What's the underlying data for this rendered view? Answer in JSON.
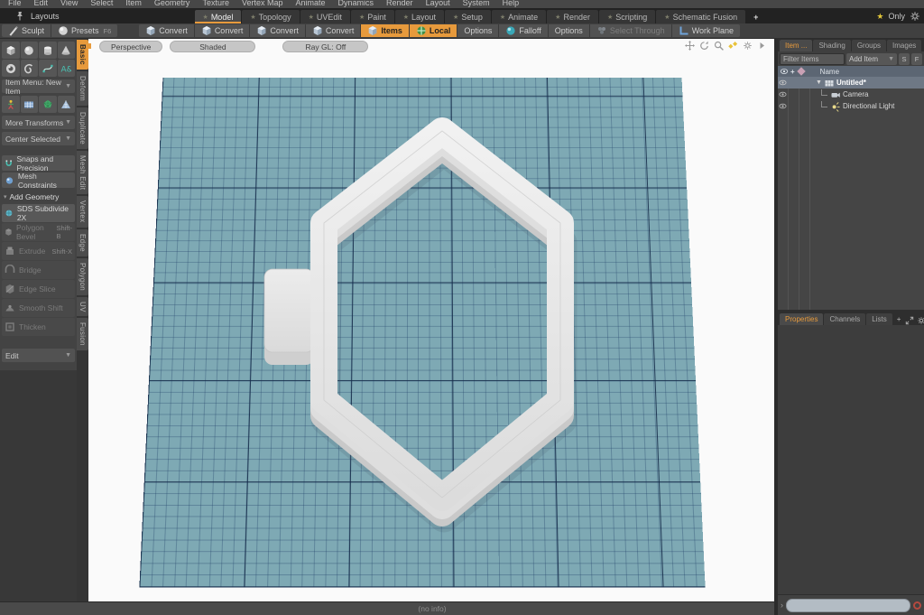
{
  "menubar": {
    "items": [
      "File",
      "Edit",
      "View",
      "Select",
      "Item",
      "Geometry",
      "Texture",
      "Vertex Map",
      "Animate",
      "Dynamics",
      "Render",
      "Layout",
      "System",
      "Help"
    ]
  },
  "layouts_bar": {
    "layouts_label": "Layouts",
    "tabs": [
      {
        "label": "Model",
        "active": true
      },
      {
        "label": "Topology"
      },
      {
        "label": "UVEdit"
      },
      {
        "label": "Paint"
      },
      {
        "label": "Layout"
      },
      {
        "label": "Setup"
      },
      {
        "label": "Animate"
      },
      {
        "label": "Render"
      },
      {
        "label": "Scripting"
      },
      {
        "label": "Schematic Fusion"
      }
    ],
    "add_tab_label": "+",
    "only_label": "Only"
  },
  "toolbar": {
    "buttons": [
      {
        "label": "Sculpt",
        "icon": "brush"
      },
      {
        "label": "Presets",
        "shortcut": "F6",
        "icon": "sphere"
      },
      {
        "label": "Convert",
        "icon": "cube"
      },
      {
        "label": "Convert",
        "icon": "cube"
      },
      {
        "label": "Convert",
        "icon": "cube"
      },
      {
        "label": "Convert",
        "icon": "cube"
      },
      {
        "label": "Items",
        "icon": "cube",
        "state": "active"
      },
      {
        "label": "Local",
        "icon": "axis-center",
        "state": "active"
      },
      {
        "label": "Options"
      },
      {
        "label": "Falloff",
        "icon": "falloff-sphere"
      },
      {
        "label": "Options"
      },
      {
        "label": "Select Through",
        "icon": "grapes",
        "state": "disabled"
      },
      {
        "label": "Work Plane",
        "icon": "work-plane"
      }
    ]
  },
  "sidebar": {
    "primitive_icons": [
      "cube",
      "sphere",
      "cylinder",
      "cone",
      "torus",
      "swirl",
      "curve",
      "text"
    ],
    "item_menu_label": "Item Menu: New Item",
    "setup_icons": [
      "skeleton",
      "ground-plane",
      "polysphere",
      "triangle-mesh"
    ],
    "more_transforms_label": "More Transforms",
    "center_selected_label": "Center Selected",
    "snaps_label": "Snaps and Precision",
    "mesh_constraints_label": "Mesh Constraints",
    "add_geometry_label": "Add Geometry",
    "tools": [
      {
        "label": "SDS Subdivide 2X",
        "shortcut": "",
        "disabled": false
      },
      {
        "label": "Polygon Bevel",
        "shortcut": "Shift-B",
        "disabled": true
      },
      {
        "label": "Extrude",
        "shortcut": "Shift-X",
        "disabled": true
      },
      {
        "label": "Bridge",
        "shortcut": "",
        "disabled": true
      },
      {
        "label": "Edge Slice",
        "shortcut": "",
        "disabled": true
      },
      {
        "label": "Smooth Shift",
        "shortcut": "",
        "disabled": true
      },
      {
        "label": "Thicken",
        "shortcut": "",
        "disabled": true
      }
    ],
    "edit_label": "Edit"
  },
  "side_tabs": {
    "items": [
      {
        "label": "Basic",
        "active": true
      },
      {
        "label": "Deform"
      },
      {
        "label": "Duplicate"
      },
      {
        "label": "Mesh Edit"
      },
      {
        "label": "Vertex"
      },
      {
        "label": "Edge"
      },
      {
        "label": "Polygon"
      },
      {
        "label": "UV"
      },
      {
        "label": "Fusion"
      }
    ]
  },
  "viewport": {
    "pills": [
      "Perspective",
      "Shaded",
      "Ray GL: Off"
    ]
  },
  "right_panel": {
    "item_tabs": [
      {
        "label": "Item ...",
        "active": true
      },
      {
        "label": "Shading"
      },
      {
        "label": "Groups"
      },
      {
        "label": "Images"
      }
    ],
    "add_tab_label": "+",
    "filter_placeholder": "Filter Items",
    "add_item_label": "Add Item",
    "mini_buttons": [
      "S",
      "F"
    ],
    "name_header": "Name",
    "tree": [
      {
        "label": "Untitled*",
        "icon": "mesh",
        "selected": true,
        "expanded": true
      },
      {
        "label": "Camera",
        "icon": "camera"
      },
      {
        "label": "Directional Light",
        "icon": "directional-light"
      }
    ],
    "props_tabs": [
      {
        "label": "Properties",
        "active": true
      },
      {
        "label": "Channels"
      },
      {
        "label": "Lists"
      }
    ],
    "props_add_label": "+"
  },
  "status_bar": {
    "text": "(no info)"
  },
  "colors": {
    "accent_orange": "#e79a3c",
    "grid_base": "#7ea9b4",
    "grid_major_line": "#1d3a58",
    "selection_row": "#6e7885",
    "viewport_bg": "#fafafa",
    "command_pill": "#b3bcc4",
    "alert_red": "#b5493f",
    "model_surface": "#e9e9e9"
  }
}
